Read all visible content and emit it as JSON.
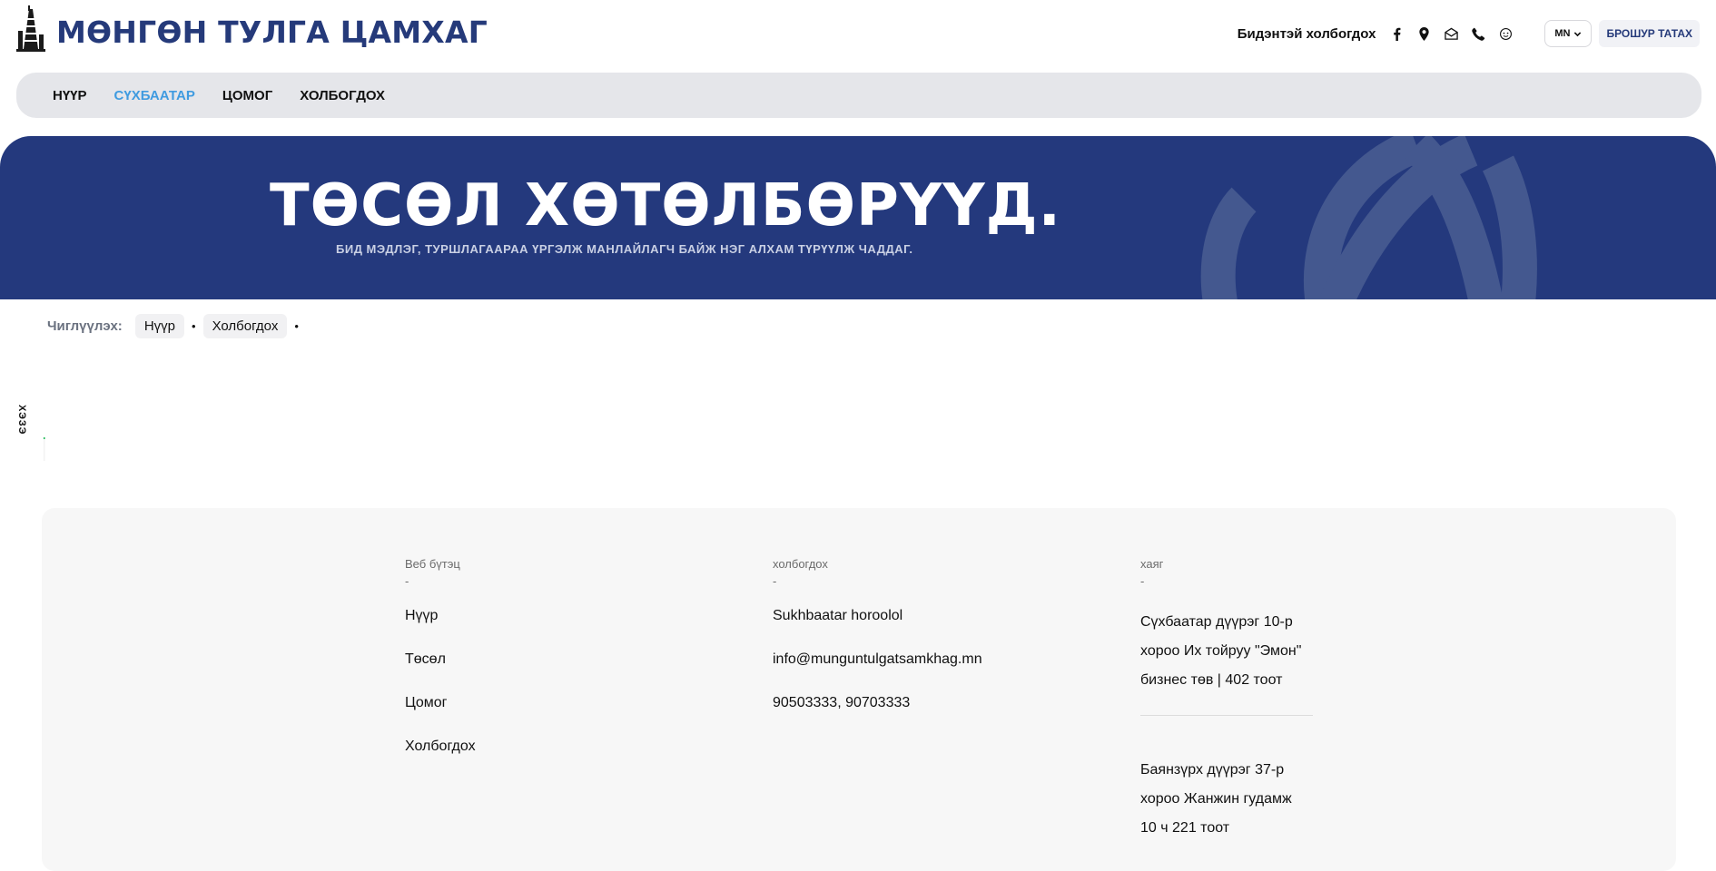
{
  "header": {
    "logo_text": "МӨНГӨН ТУЛГА ЦАМХАГ",
    "contact_label": "Бидэнтэй холбогдох",
    "contact_icons": [
      "facebook-icon",
      "map-pin-icon",
      "envelope-icon",
      "phone-icon",
      "chat-icon"
    ],
    "lang": "MN",
    "brochure_label": "БРОШУР ТАТАХ"
  },
  "nav": {
    "items": [
      {
        "label": "НҮҮР"
      },
      {
        "label": "СҮХБААТАР",
        "active": true
      },
      {
        "label": "ЦОМОГ"
      },
      {
        "label": "ХОЛБОГДОХ"
      }
    ]
  },
  "hero": {
    "title": "ТӨСӨЛ ХӨТӨЛБӨРҮҮД.",
    "subtitle": "БИД МЭДЛЭГ, ТУРШЛАГААРАА ҮРГЭЛЖ МАНЛАЙЛАГЧ БАЙЖ НЭГ АЛХАМ ТҮРҮҮЛЖ ЧАДДАГ."
  },
  "breadcrumb": {
    "label": "Чиглүүлэх:",
    "items": [
      "Нүүр",
      "Холбогдох"
    ]
  },
  "side_tab": {
    "label": "ХЭЗЭ"
  },
  "footer": {
    "col1": {
      "heading": "Веб бүтэц",
      "dash": "-",
      "items": [
        "Нүүр",
        "Төсөл",
        "Цомог",
        "Холбогдох"
      ]
    },
    "col2": {
      "heading": "холбогдох",
      "dash": "-",
      "items": [
        "Sukhbaatar horoolol",
        "info@munguntulgatsamkhag.mn",
        "90503333, 90703333"
      ]
    },
    "col3": {
      "heading": "хаяг",
      "dash": "-",
      "address1": [
        "Сүхбаатар дүүрэг 10-р",
        "хороо Их тойруу \"Эмон\"",
        "бизнес төв | 402 тоот"
      ],
      "address2": [
        "Баянзүрх дүүрэг 37-р",
        "хороо Жанжин гудамж",
        "10 ч 221 тоот"
      ]
    }
  },
  "colors": {
    "brand_blue": "#253a7a",
    "hero_bg": "#24397d",
    "nav_active": "#3f9be0",
    "nav_bg": "#e5e6ea"
  }
}
